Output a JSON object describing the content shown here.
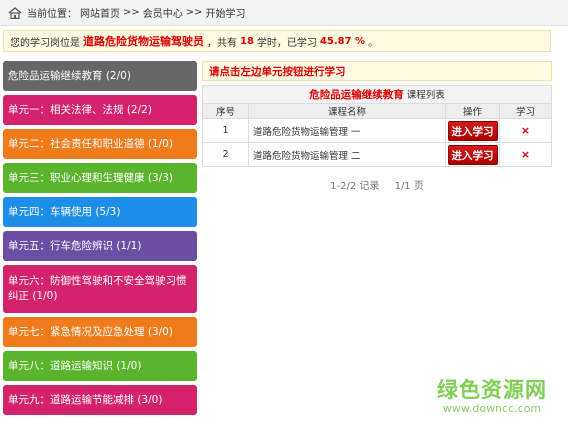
{
  "breadcrumb": {
    "location_label": "当前位置：",
    "items": [
      "网站首页",
      "会员中心",
      "开始学习"
    ],
    "separator": ">>"
  },
  "notice": {
    "prefix": "您的学习岗位是",
    "post_name": "道路危险货物运输驾驶员",
    "middle": "，共有",
    "total_hours": "18",
    "hours_text": "学时，已学习",
    "percent": "45.87 %",
    "suffix": "。"
  },
  "sidebar": {
    "items": [
      {
        "label": "危险品运输继续教育 (2/0)",
        "color": "#666666"
      },
      {
        "label": "单元一：相关法律、法规 (2/2)",
        "color": "#d5226d"
      },
      {
        "label": "单元二：社会责任和职业道德 (1/0)",
        "color": "#f07b1b"
      },
      {
        "label": "单元三：职业心理和生理健康 (3/3)",
        "color": "#5ab52c"
      },
      {
        "label": "单元四：车辆使用 (5/3)",
        "color": "#1d8ee8"
      },
      {
        "label": "单元五：行车危险辨识 (1/1)",
        "color": "#6a4fa3"
      },
      {
        "label": "单元六：防御性驾驶和不安全驾驶习惯纠正 (1/0)",
        "color": "#d5226d"
      },
      {
        "label": "单元七：紧急情况及应急处理 (3/0)",
        "color": "#f07b1b"
      },
      {
        "label": "单元八：道路运输知识 (1/0)",
        "color": "#5ab52c"
      },
      {
        "label": "单元九：道路运输节能减排 (3/0)",
        "color": "#d5226d"
      }
    ]
  },
  "content": {
    "prompt": "请点击左边单元按钮进行学习",
    "table_title": "危险品运输继续教育",
    "table_title_suffix": "课程列表",
    "columns": [
      "序号",
      "课程名称",
      "操作",
      "学习"
    ],
    "rows": [
      {
        "index": "1",
        "name": "道路危险货物运输管理 一",
        "action": "进入学习",
        "status": "×"
      },
      {
        "index": "2",
        "name": "道路危险货物运输管理 二",
        "action": "进入学习",
        "status": "×"
      }
    ],
    "pager": {
      "records": "1-2/2 记录",
      "pages": "1/1 页"
    }
  },
  "watermark": {
    "main": "绿色资源网",
    "sub": "www.downcc.com"
  },
  "colors": {
    "accent_red": "#e00000",
    "button_red": "#c41010"
  },
  "icons": {
    "home": "home-icon"
  }
}
